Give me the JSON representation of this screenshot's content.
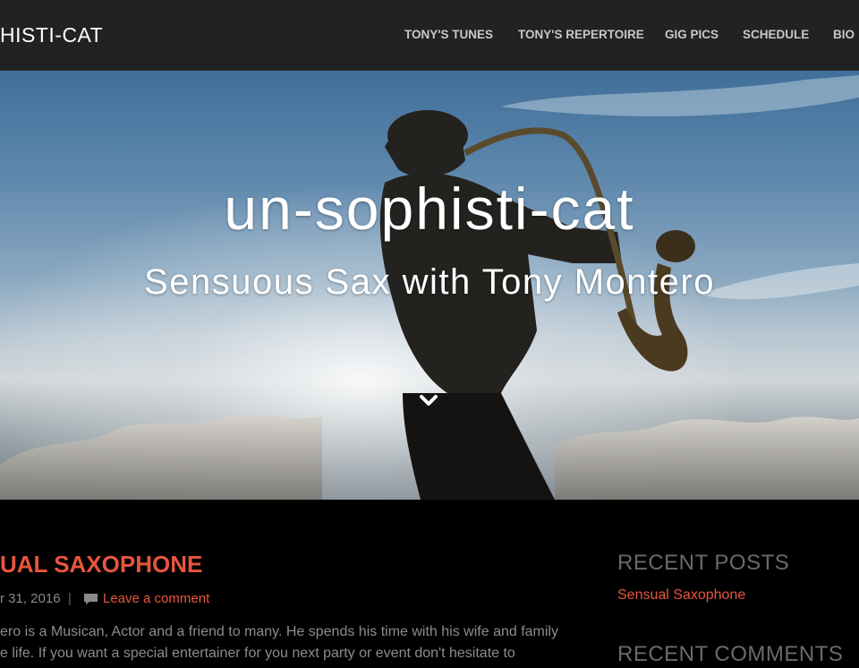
{
  "header": {
    "site_title": "HISTI-CAT",
    "nav": [
      {
        "label": "TONY'S TUNES"
      },
      {
        "label": "TONY'S REPERTOIRE"
      },
      {
        "label": "GIG PICS"
      },
      {
        "label": "SCHEDULE"
      },
      {
        "label": "BIO"
      }
    ]
  },
  "hero": {
    "title": "un-sophisti-cat",
    "subtitle": "Sensuous Sax with Tony Montero",
    "scroll_icon": "chevron-down-icon"
  },
  "post": {
    "title": "UAL SAXOPHONE",
    "date": "r 31, 2016",
    "separator": "|",
    "comment_icon": "comment-icon",
    "comment_link": "Leave a comment",
    "excerpt_lines": [
      "ero is a Musican, Actor and a friend to many. He spends his time with his wife and family",
      "e life. If you want a special entertainer for you next party or event don't hesitate to"
    ]
  },
  "sidebar": {
    "recent_posts_heading": "RECENT POSTS",
    "recent_post_link": "Sensual Saxophone",
    "recent_comments_heading": "RECENT COMMENTS"
  },
  "colors": {
    "header_bg": "#222222",
    "accent": "#e8553e",
    "page_bg": "#000000"
  }
}
